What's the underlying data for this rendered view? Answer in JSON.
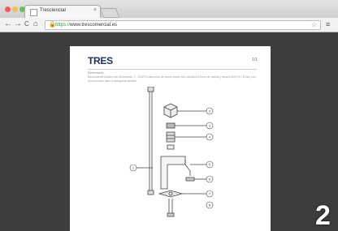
{
  "browser": {
    "tab_title": "Tresciencial",
    "tab_close": "×",
    "url_scheme": "https://",
    "url_host": "www.trescomercial.es",
    "lock_icon": "lock-icon",
    "nav": {
      "back": "←",
      "forward": "→",
      "reload": "C",
      "home": "⌂"
    },
    "star": "☆",
    "menu": "≡"
  },
  "document": {
    "logo": "TRES",
    "page_number": "1/1",
    "subtitle": "Referencia",
    "description": "Monomando lavabo con Monotrade. 1 - 00370 Cartuchos de cierre suave con caudal a 5 l/min de caudal y ahorro 40% (3 - 5 bar) con rosca enlace latón y manguera flexible.",
    "callouts": [
      "1",
      "2",
      "3",
      "4",
      "5",
      "6",
      "7",
      "8"
    ]
  },
  "overlay": {
    "step_number": "2"
  },
  "colors": {
    "logo": "#1f2f6b",
    "lock": "#2a9d3a",
    "viewer_bg": "#3d3d3d"
  }
}
